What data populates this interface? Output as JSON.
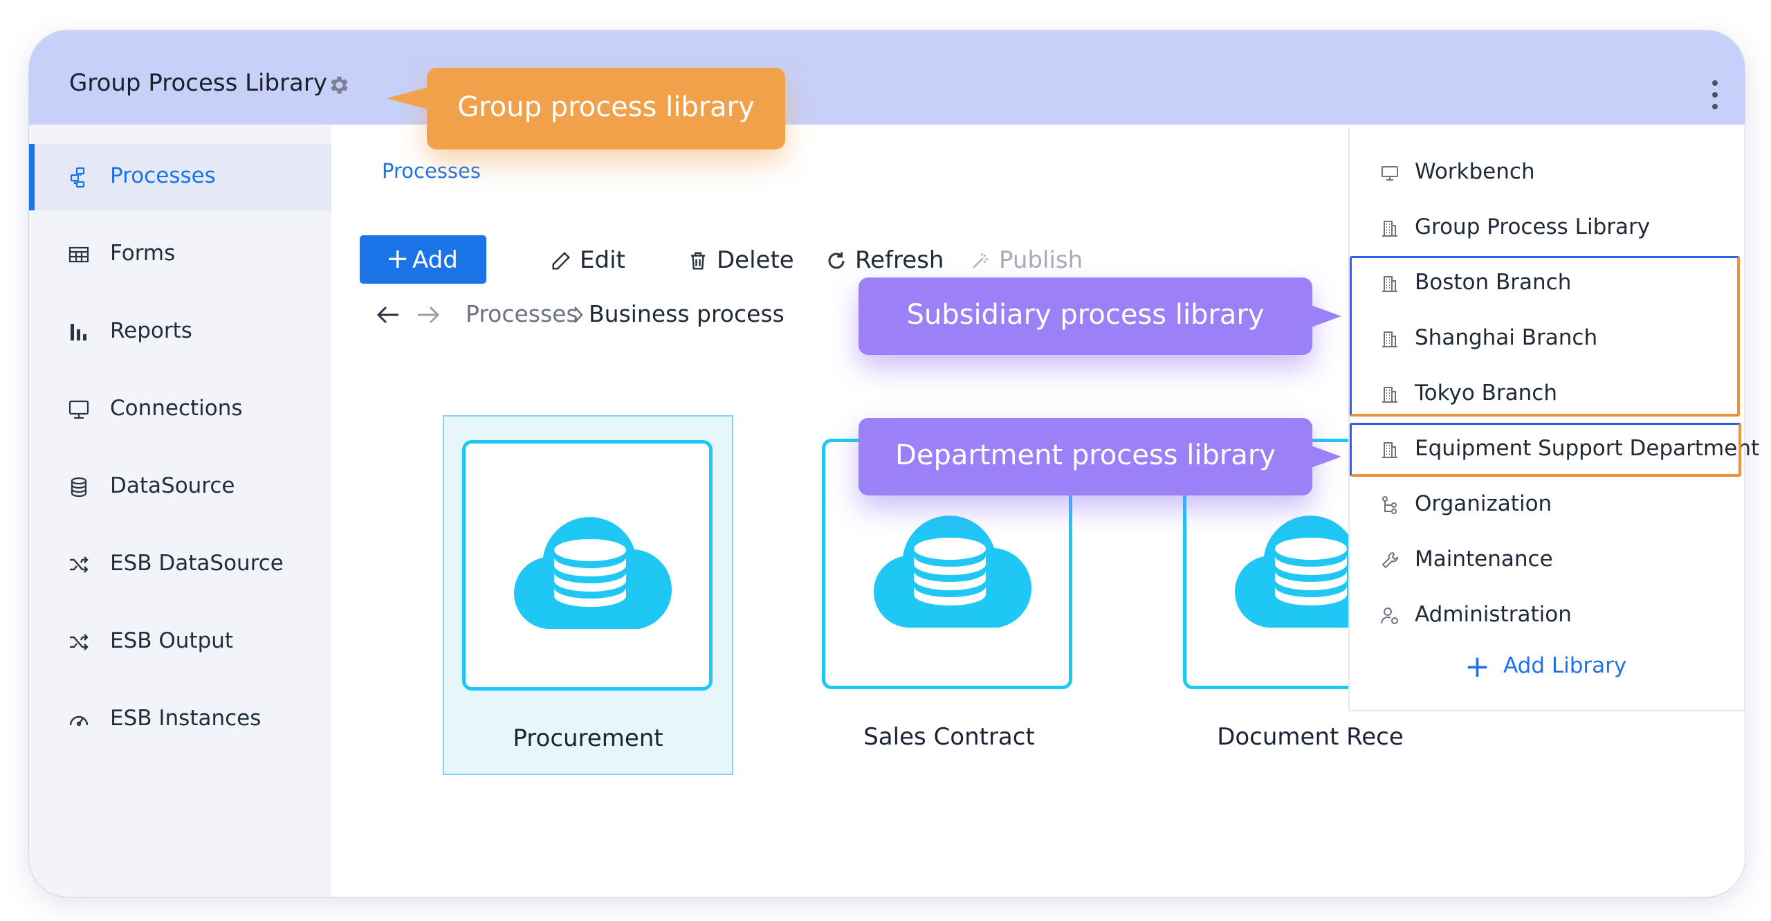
{
  "header": {
    "title": "Group Process Library",
    "icons": {
      "settings": "gear-icon",
      "menu": "vertical-dots-icon"
    }
  },
  "sidebar": {
    "items": [
      {
        "label": "Processes",
        "icon": "flow-icon",
        "active": true
      },
      {
        "label": "Forms",
        "icon": "table-icon",
        "active": false
      },
      {
        "label": "Reports",
        "icon": "bar-chart-icon",
        "active": false
      },
      {
        "label": "Connections",
        "icon": "monitor-icon",
        "active": false
      },
      {
        "label": "DataSource",
        "icon": "database-icon",
        "active": false
      },
      {
        "label": "ESB DataSource",
        "icon": "shuffle-icon",
        "active": false
      },
      {
        "label": "ESB Output",
        "icon": "shuffle-icon",
        "active": false
      },
      {
        "label": "ESB Instances",
        "icon": "gauge-icon",
        "active": false
      }
    ]
  },
  "main": {
    "breadcrumb": "Processes",
    "toolbar": {
      "add": "Add",
      "edit": "Edit",
      "delete": "Delete",
      "refresh": "Refresh",
      "publish": "Publish"
    },
    "path": {
      "root": "Processes",
      "current": "Business process"
    },
    "cards": [
      {
        "label": "Procurement",
        "selected": true,
        "icon": "cloud-database-icon"
      },
      {
        "label": "Sales Contract",
        "selected": false,
        "icon": "cloud-database-icon"
      },
      {
        "label": "Document Rece",
        "selected": false,
        "icon": "cloud-database-icon"
      }
    ]
  },
  "library_menu": {
    "items": [
      {
        "label": "Workbench",
        "icon": "monitor-icon"
      },
      {
        "label": "Group Process Library",
        "icon": "building-icon"
      },
      {
        "label": "Boston Branch",
        "icon": "building-icon"
      },
      {
        "label": "Shanghai Branch",
        "icon": "building-icon"
      },
      {
        "label": "Tokyo Branch",
        "icon": "building-icon"
      },
      {
        "label": "Equipment Support Department",
        "icon": "building-icon"
      },
      {
        "label": "Organization",
        "icon": "org-tree-icon"
      },
      {
        "label": "Maintenance",
        "icon": "wrench-icon"
      },
      {
        "label": "Administration",
        "icon": "user-gear-icon"
      }
    ],
    "add_label": "Add Library"
  },
  "annotations": {
    "group": "Group process library",
    "subsidiary": "Subsidiary process library",
    "department": "Department process library"
  },
  "colors": {
    "accent": "#1b73e8",
    "header_bg": "#c7d0f8",
    "card_border": "#1ec7f4",
    "callout_orange": "#f0a14a",
    "callout_purple": "#9b80f8",
    "highlight_blue": "#2f5ff0",
    "highlight_orange": "#f0913a"
  }
}
